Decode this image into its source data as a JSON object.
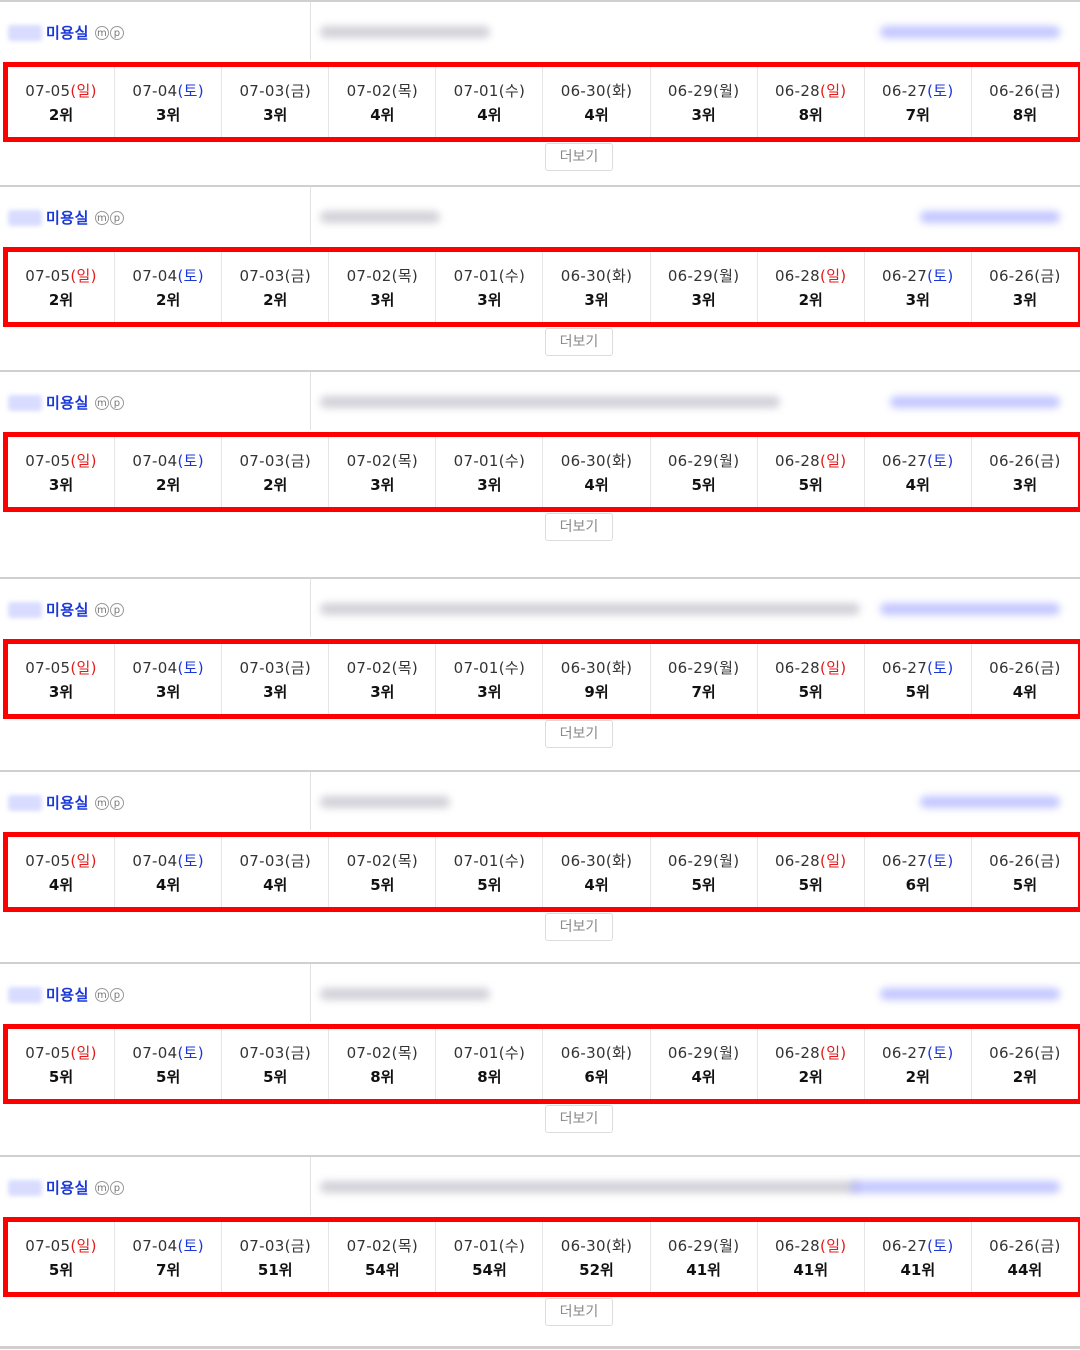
{
  "more_label": "더보기",
  "colors": {
    "border": "#ff0000",
    "sunday": "#e21c1c",
    "saturday": "#1a37d8",
    "keyword": "#1a37d8"
  },
  "blocks": [
    {
      "keyword": "미용실",
      "badges": [
        "m",
        "p"
      ],
      "days": [
        {
          "date": "07-05",
          "dow": "일",
          "rank": "2위"
        },
        {
          "date": "07-04",
          "dow": "토",
          "rank": "3위"
        },
        {
          "date": "07-03",
          "dow": "금",
          "rank": "3위"
        },
        {
          "date": "07-02",
          "dow": "목",
          "rank": "4위"
        },
        {
          "date": "07-01",
          "dow": "수",
          "rank": "4위"
        },
        {
          "date": "06-30",
          "dow": "화",
          "rank": "4위"
        },
        {
          "date": "06-29",
          "dow": "월",
          "rank": "3위"
        },
        {
          "date": "06-28",
          "dow": "일",
          "rank": "8위"
        },
        {
          "date": "06-27",
          "dow": "토",
          "rank": "7위"
        },
        {
          "date": "06-26",
          "dow": "금",
          "rank": "8위"
        }
      ]
    },
    {
      "keyword": "미용실",
      "badges": [
        "m",
        "p"
      ],
      "days": [
        {
          "date": "07-05",
          "dow": "일",
          "rank": "2위"
        },
        {
          "date": "07-04",
          "dow": "토",
          "rank": "2위"
        },
        {
          "date": "07-03",
          "dow": "금",
          "rank": "2위"
        },
        {
          "date": "07-02",
          "dow": "목",
          "rank": "3위"
        },
        {
          "date": "07-01",
          "dow": "수",
          "rank": "3위"
        },
        {
          "date": "06-30",
          "dow": "화",
          "rank": "3위"
        },
        {
          "date": "06-29",
          "dow": "월",
          "rank": "3위"
        },
        {
          "date": "06-28",
          "dow": "일",
          "rank": "2위"
        },
        {
          "date": "06-27",
          "dow": "토",
          "rank": "3위"
        },
        {
          "date": "06-26",
          "dow": "금",
          "rank": "3위"
        }
      ]
    },
    {
      "keyword": "미용실",
      "badges": [
        "m",
        "p"
      ],
      "days": [
        {
          "date": "07-05",
          "dow": "일",
          "rank": "3위"
        },
        {
          "date": "07-04",
          "dow": "토",
          "rank": "2위"
        },
        {
          "date": "07-03",
          "dow": "금",
          "rank": "2위"
        },
        {
          "date": "07-02",
          "dow": "목",
          "rank": "3위"
        },
        {
          "date": "07-01",
          "dow": "수",
          "rank": "3위"
        },
        {
          "date": "06-30",
          "dow": "화",
          "rank": "4위"
        },
        {
          "date": "06-29",
          "dow": "월",
          "rank": "5위"
        },
        {
          "date": "06-28",
          "dow": "일",
          "rank": "5위"
        },
        {
          "date": "06-27",
          "dow": "토",
          "rank": "4위"
        },
        {
          "date": "06-26",
          "dow": "금",
          "rank": "3위"
        }
      ]
    },
    {
      "keyword": "미용실",
      "badges": [
        "m",
        "p"
      ],
      "days": [
        {
          "date": "07-05",
          "dow": "일",
          "rank": "3위"
        },
        {
          "date": "07-04",
          "dow": "토",
          "rank": "3위"
        },
        {
          "date": "07-03",
          "dow": "금",
          "rank": "3위"
        },
        {
          "date": "07-02",
          "dow": "목",
          "rank": "3위"
        },
        {
          "date": "07-01",
          "dow": "수",
          "rank": "3위"
        },
        {
          "date": "06-30",
          "dow": "화",
          "rank": "9위"
        },
        {
          "date": "06-29",
          "dow": "월",
          "rank": "7위"
        },
        {
          "date": "06-28",
          "dow": "일",
          "rank": "5위"
        },
        {
          "date": "06-27",
          "dow": "토",
          "rank": "5위"
        },
        {
          "date": "06-26",
          "dow": "금",
          "rank": "4위"
        }
      ]
    },
    {
      "keyword": "미용실",
      "badges": [
        "m",
        "p"
      ],
      "days": [
        {
          "date": "07-05",
          "dow": "일",
          "rank": "4위"
        },
        {
          "date": "07-04",
          "dow": "토",
          "rank": "4위"
        },
        {
          "date": "07-03",
          "dow": "금",
          "rank": "4위"
        },
        {
          "date": "07-02",
          "dow": "목",
          "rank": "5위"
        },
        {
          "date": "07-01",
          "dow": "수",
          "rank": "5위"
        },
        {
          "date": "06-30",
          "dow": "화",
          "rank": "4위"
        },
        {
          "date": "06-29",
          "dow": "월",
          "rank": "5위"
        },
        {
          "date": "06-28",
          "dow": "일",
          "rank": "5위"
        },
        {
          "date": "06-27",
          "dow": "토",
          "rank": "6위"
        },
        {
          "date": "06-26",
          "dow": "금",
          "rank": "5위"
        }
      ]
    },
    {
      "keyword": "미용실",
      "badges": [
        "m",
        "p"
      ],
      "days": [
        {
          "date": "07-05",
          "dow": "일",
          "rank": "5위"
        },
        {
          "date": "07-04",
          "dow": "토",
          "rank": "5위"
        },
        {
          "date": "07-03",
          "dow": "금",
          "rank": "5위"
        },
        {
          "date": "07-02",
          "dow": "목",
          "rank": "8위"
        },
        {
          "date": "07-01",
          "dow": "수",
          "rank": "8위"
        },
        {
          "date": "06-30",
          "dow": "화",
          "rank": "6위"
        },
        {
          "date": "06-29",
          "dow": "월",
          "rank": "4위"
        },
        {
          "date": "06-28",
          "dow": "일",
          "rank": "2위"
        },
        {
          "date": "06-27",
          "dow": "토",
          "rank": "2위"
        },
        {
          "date": "06-26",
          "dow": "금",
          "rank": "2위"
        }
      ]
    },
    {
      "keyword": "미용실",
      "badges": [
        "m",
        "p"
      ],
      "days": [
        {
          "date": "07-05",
          "dow": "일",
          "rank": "5위"
        },
        {
          "date": "07-04",
          "dow": "토",
          "rank": "7위"
        },
        {
          "date": "07-03",
          "dow": "금",
          "rank": "51위"
        },
        {
          "date": "07-02",
          "dow": "목",
          "rank": "54위"
        },
        {
          "date": "07-01",
          "dow": "수",
          "rank": "54위"
        },
        {
          "date": "06-30",
          "dow": "화",
          "rank": "52위"
        },
        {
          "date": "06-29",
          "dow": "월",
          "rank": "41위"
        },
        {
          "date": "06-28",
          "dow": "일",
          "rank": "41위"
        },
        {
          "date": "06-27",
          "dow": "토",
          "rank": "41위"
        },
        {
          "date": "06-26",
          "dow": "금",
          "rank": "44위"
        }
      ]
    }
  ]
}
